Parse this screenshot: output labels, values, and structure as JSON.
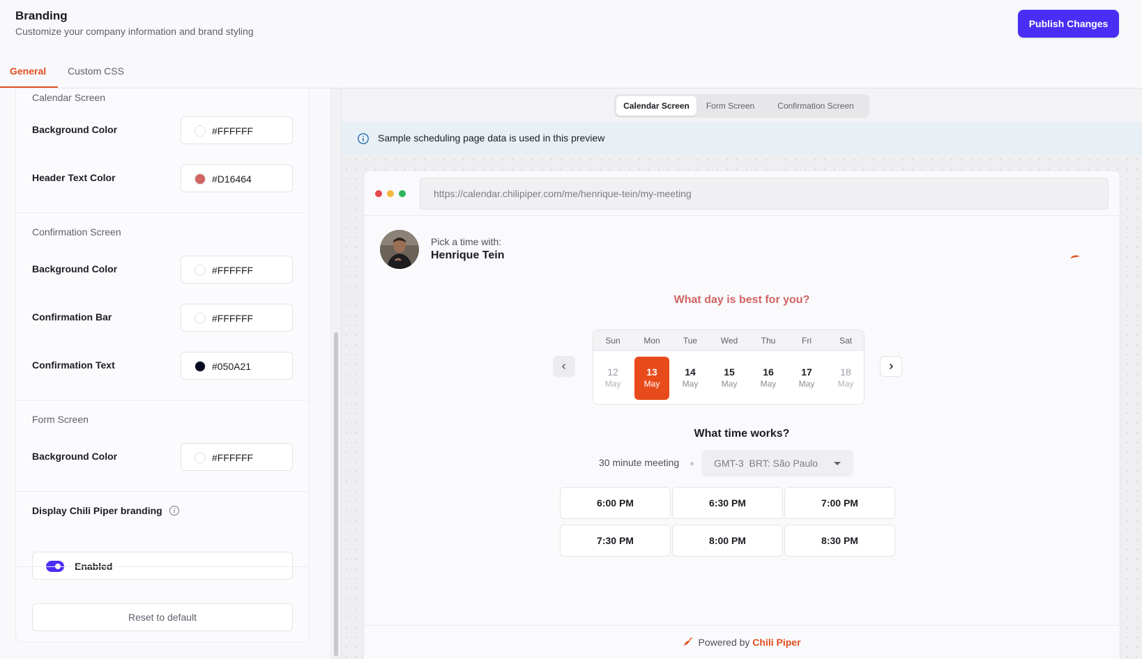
{
  "header": {
    "title": "Branding",
    "subtitle": "Customize your company information and brand styling",
    "publish_label": "Publish Changes"
  },
  "tabs": [
    {
      "label": "General",
      "active": true
    },
    {
      "label": "Custom CSS",
      "active": false
    }
  ],
  "settings": {
    "calendar_screen": {
      "title": "Calendar Screen",
      "fields": [
        {
          "label": "Background Color",
          "value": "#FFFFFF",
          "swatch": "#FFFFFF"
        },
        {
          "label": "Header Text Color",
          "value": "#D16464",
          "swatch": "#D16464"
        }
      ]
    },
    "confirmation_screen": {
      "title": "Confirmation Screen",
      "fields": [
        {
          "label": "Background Color",
          "value": "#FFFFFF",
          "swatch": "#FFFFFF"
        },
        {
          "label": "Confirmation Bar",
          "value": "#FFFFFF",
          "swatch": "#FFFFFF"
        },
        {
          "label": "Confirmation Text",
          "value": "#050A21",
          "swatch": "#050A21"
        }
      ]
    },
    "form_screen": {
      "title": "Form Screen",
      "fields": [
        {
          "label": "Background Color",
          "value": "#FFFFFF",
          "swatch": "#FFFFFF"
        }
      ]
    },
    "branding": {
      "label": "Display Chili Piper branding",
      "toggle_label": "Enabled",
      "enabled": true
    },
    "reset_label": "Reset to default"
  },
  "preview": {
    "screens": [
      {
        "label": "Calendar Screen",
        "active": true
      },
      {
        "label": "Form Screen",
        "active": false
      },
      {
        "label": "Confirmation Screen",
        "active": false
      }
    ],
    "notice": "Sample scheduling page data is used in this preview",
    "url": "https://calendar.chilipiper.com/me/henrique-tein/my-meeting",
    "host_pre": "Pick a time with:",
    "host_name": "Henrique Tein",
    "day_question": "What day is best for you?",
    "weekdays": [
      "Sun",
      "Mon",
      "Tue",
      "Wed",
      "Thu",
      "Fri",
      "Sat"
    ],
    "dates": [
      {
        "day": "12",
        "month": "May",
        "state": "disabled"
      },
      {
        "day": "13",
        "month": "May",
        "state": "selected"
      },
      {
        "day": "14",
        "month": "May",
        "state": "available"
      },
      {
        "day": "15",
        "month": "May",
        "state": "available"
      },
      {
        "day": "16",
        "month": "May",
        "state": "available"
      },
      {
        "day": "17",
        "month": "May",
        "state": "available"
      },
      {
        "day": "18",
        "month": "May",
        "state": "disabled"
      }
    ],
    "time_question": "What time works?",
    "meeting_length": "30 minute meeting",
    "timezone": "GMT-3  BRT: São Paulo",
    "slots": [
      "6:00 PM",
      "6:30 PM",
      "7:00 PM",
      "7:30 PM",
      "8:00 PM",
      "8:30 PM"
    ],
    "powered_pre": "Powered by",
    "powered_brand": "Chili Piper"
  },
  "colors": {
    "accent": "#4B2EF5",
    "brand_orange": "#E04E1F",
    "selected_date": "#E84B1B",
    "header_text": "#D16464"
  },
  "icons": {
    "info": "info-circle-icon",
    "chevron_left": "chevron-left-icon",
    "chevron_right": "chevron-right-icon",
    "caret_down": "caret-down-icon",
    "chili": "chili-pepper-icon"
  }
}
